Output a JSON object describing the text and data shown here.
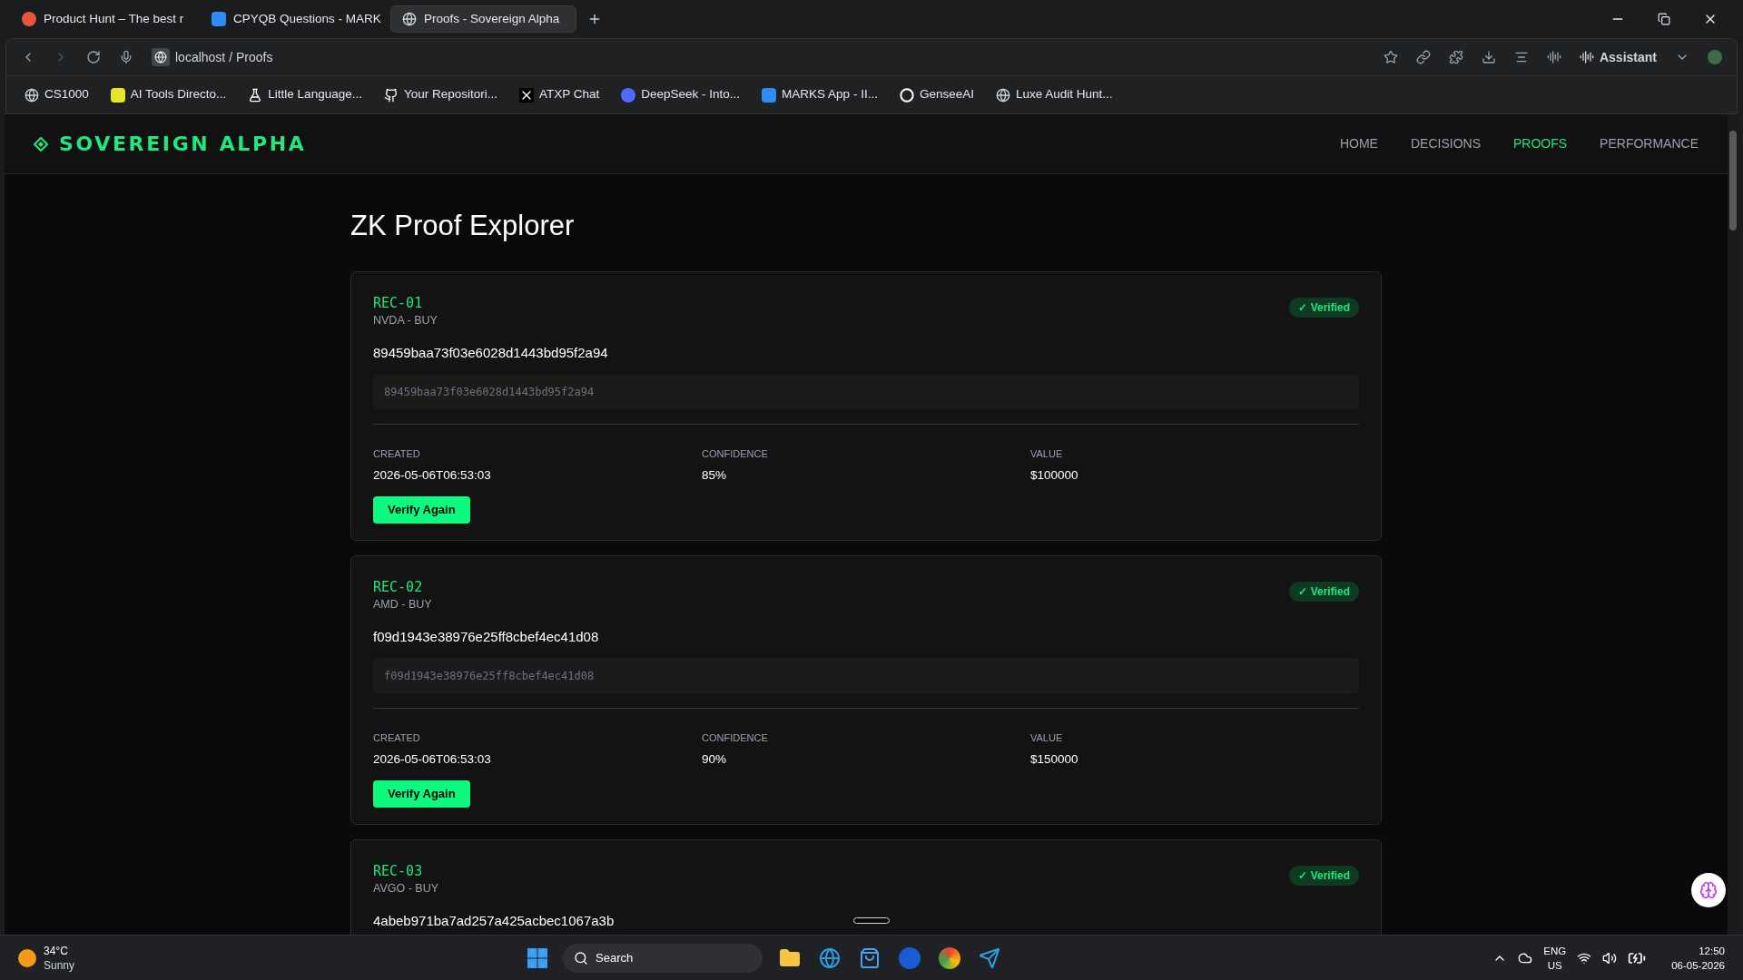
{
  "browser": {
    "tabs": [
      {
        "title": "Product Hunt – The best r",
        "selected": false
      },
      {
        "title": "CPYQB Questions - MARK",
        "selected": false
      },
      {
        "title": "Proofs - Sovereign Alpha",
        "selected": true
      }
    ],
    "address": "localhost / Proofs",
    "assistant": "Assistant",
    "bookmarks": [
      "CS1000",
      "AI Tools Directo...",
      "Little Language...",
      "Your Repositori...",
      "ATXP Chat",
      "DeepSeek - Into...",
      "MARKS App - II...",
      "GenseeAI",
      "Luxe Audit Hunt..."
    ]
  },
  "app": {
    "brand": "SOVEREIGN ALPHA",
    "nav": [
      {
        "label": "HOME",
        "selected": false
      },
      {
        "label": "DECISIONS",
        "selected": false
      },
      {
        "label": "PROOFS",
        "selected": true
      },
      {
        "label": "PERFORMANCE",
        "selected": false
      }
    ],
    "page_title": "ZK Proof Explorer",
    "proofs": [
      {
        "id": "REC-01",
        "subtitle": "NVDA - BUY",
        "status": "✓ Verified",
        "hash": "89459baa73f03e6028d1443bd95f2a94",
        "hash_box": "89459baa73f03e6028d1443bd95f2a94",
        "fields": [
          {
            "label": "CREATED",
            "value": "2026-05-06T06:53:03"
          },
          {
            "label": "CONFIDENCE",
            "value": "85%"
          },
          {
            "label": "VALUE",
            "value": "$100000"
          }
        ],
        "button": "Verify Again"
      },
      {
        "id": "REC-02",
        "subtitle": "AMD - BUY",
        "status": "✓ Verified",
        "hash": "f09d1943e38976e25ff8cbef4ec41d08",
        "hash_box": "f09d1943e38976e25ff8cbef4ec41d08",
        "fields": [
          {
            "label": "CREATED",
            "value": "2026-05-06T06:53:03"
          },
          {
            "label": "CONFIDENCE",
            "value": "90%"
          },
          {
            "label": "VALUE",
            "value": "$150000"
          }
        ],
        "button": "Verify Again"
      },
      {
        "id": "REC-03",
        "subtitle": "AVGO - BUY",
        "status": "✓ Verified",
        "hash": "4abeb971ba7ad257a425acbec1067a3b"
      }
    ]
  },
  "taskbar": {
    "temperature": "34°C",
    "weather": "Sunny",
    "search": "Search",
    "language": "ENG",
    "region": "US",
    "time": "12:50",
    "date": "06-05-2026"
  }
}
